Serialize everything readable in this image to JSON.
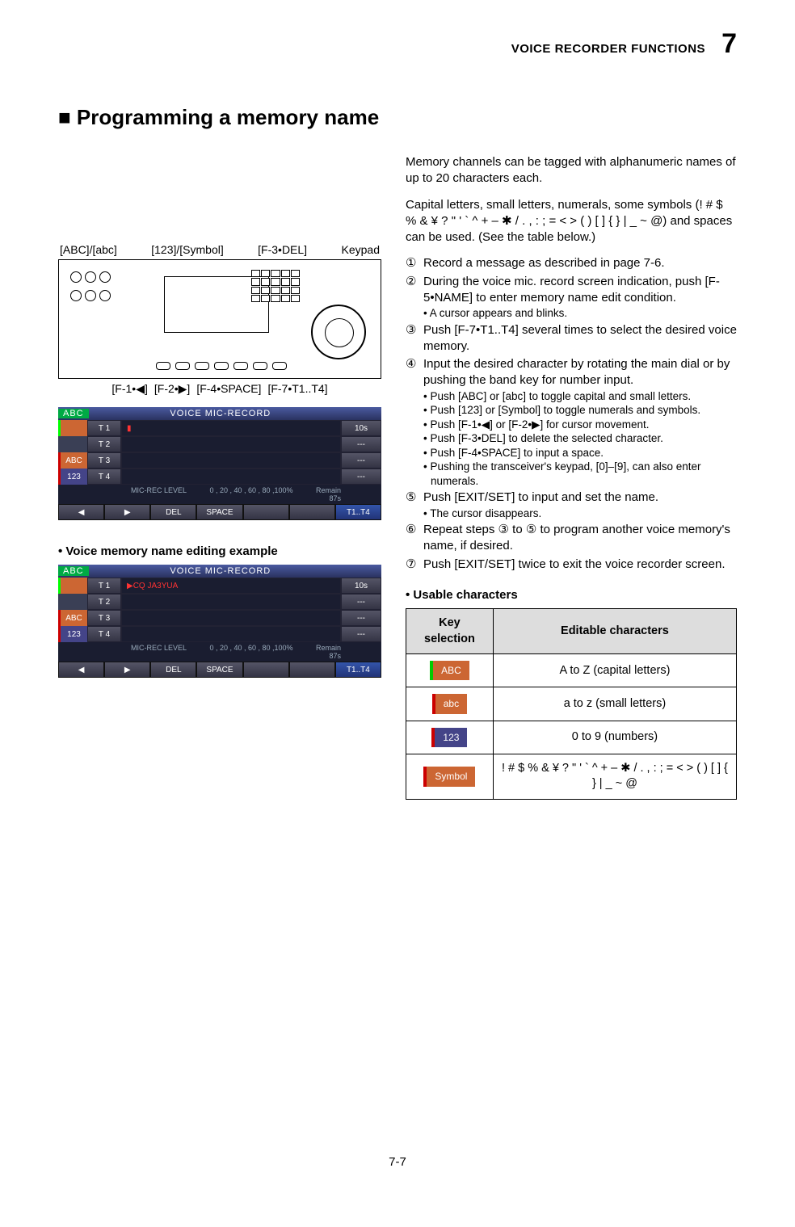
{
  "header": {
    "section": "VOICE RECORDER FUNCTIONS",
    "chapter": "7"
  },
  "heading": "■ Programming a memory name",
  "intro1": "Memory channels can be tagged with alphanumeric names of up to 20 characters each.",
  "intro2_a": "Capital letters, small letters, numerals, some symbols (! # $ % & ¥ ? \" ' ` ^ + – ",
  "intro2_b": " / . , : ; = < > ( ) [ ] { } | _ ~ @) and spaces can be used. (See the table below.)",
  "callouts_top": {
    "a": "[ABC]/[abc]",
    "b": "[123]/[Symbol]",
    "c": "[F-3•DEL]",
    "d": "Keypad"
  },
  "callouts_bottom": {
    "a": "[F-1•◀]",
    "b": "[F-2•▶]",
    "c": "[F-4•SPACE]",
    "d": "[F-7•T1..T4]"
  },
  "steps": [
    {
      "n": "①",
      "text": "Record a message as described in page 7-6."
    },
    {
      "n": "②",
      "text": "During the voice mic. record screen indication, push [F-5•NAME] to enter memory name edit condition.",
      "subs": [
        "• A cursor appears and blinks."
      ]
    },
    {
      "n": "③",
      "text": "Push [F-7•T1..T4] several times to select the desired voice memory."
    },
    {
      "n": "④",
      "text": "Input the desired character by rotating the main dial or by pushing the band key for number input.",
      "subs": [
        "• Push [ABC] or [abc] to toggle capital and small letters.",
        "• Push [123] or [Symbol] to toggle numerals and symbols.",
        "• Push [F-1•◀] or [F-2•▶] for cursor movement.",
        "• Push [F-3•DEL] to delete the selected character.",
        "• Push [F-4•SPACE] to input a space.",
        "• Pushing the transceiver's keypad, [0]–[9], can also enter numerals."
      ]
    },
    {
      "n": "⑤",
      "text": "Push [EXIT/SET] to input and set the name.",
      "subs": [
        "• The cursor disappears."
      ]
    },
    {
      "n": "⑥",
      "text_a": "Repeat steps ",
      "text_b": " to ",
      "text_c": " to program another voice memory's name, if desired.",
      "ref_a": "③",
      "ref_b": "⑤"
    },
    {
      "n": "⑦",
      "text": "Push [EXIT/SET] twice to exit the voice recorder screen."
    }
  ],
  "lcd": {
    "title": "VOICE  MIC-RECORD",
    "abc": "ABC",
    "tabs": {
      "abc": "ABC",
      "num": "123"
    },
    "rows": [
      {
        "label": "T 1",
        "content": "▮",
        "right": "10s"
      },
      {
        "label": "T 2",
        "content": "",
        "right": "---"
      },
      {
        "label": "T 3",
        "content": "",
        "right": "---"
      },
      {
        "label": "T 4",
        "content": "",
        "right": "---"
      }
    ],
    "meter_label": "MIC-REC  LEVEL",
    "meter_ticks": "0 , 20 , 40 , 60 , 80 ,100%",
    "remain_label": "Remain",
    "remain_val": "87s",
    "fkeys": [
      "◀",
      "▶",
      "DEL",
      "SPACE",
      "",
      "",
      "T1..T4"
    ]
  },
  "example_label": "• Voice memory name editing example",
  "lcd2_row1_content": "▶CQ  JA3YUA",
  "usable_heading": "• Usable characters",
  "table": {
    "h1": "Key selection",
    "h2": "Editable characters",
    "rows": [
      {
        "key": "ABC",
        "cls": "abc-cap",
        "desc": "A to Z (capital letters)"
      },
      {
        "key": "abc",
        "cls": "abc-low",
        "desc": "a to z (small letters)"
      },
      {
        "key": "123",
        "cls": "k123",
        "desc": "0 to 9 (numbers)"
      },
      {
        "key": "Symbol",
        "cls": "ksym",
        "desc_a": "! # $ % & ¥ ? \" ' ` ^ + – ",
        "desc_b": " / . , : ; = < > ( ) [ ] { } | _ ~ @"
      }
    ]
  },
  "page_number": "7-7"
}
